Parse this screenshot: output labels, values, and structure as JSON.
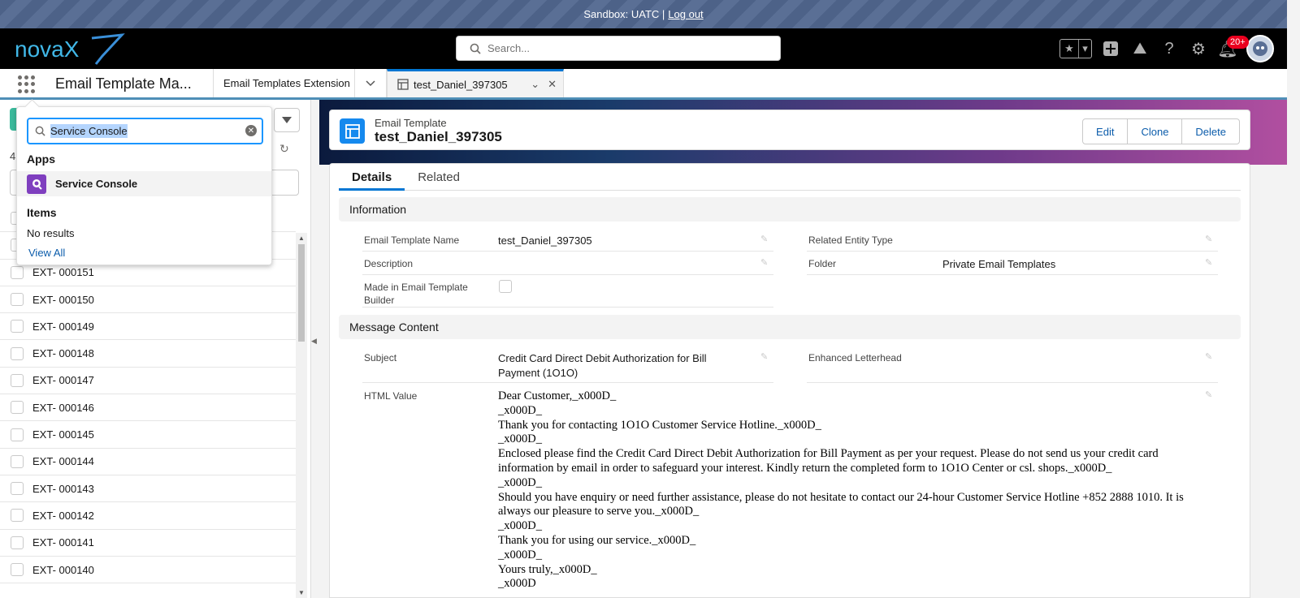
{
  "sandbox": {
    "text": "Sandbox: UATC |",
    "logout": "Log out"
  },
  "header": {
    "logo": "novaX",
    "search_placeholder": "Search...",
    "notif_badge": "20+"
  },
  "nav": {
    "app_name": "Email Template Ma...",
    "tabs": [
      {
        "label": "Email Templates Extension"
      },
      {
        "label": "test_Daniel_397305"
      }
    ]
  },
  "launcher": {
    "search_value": "Service Console",
    "apps_heading": "Apps",
    "app_result": "Service Console",
    "items_heading": "Items",
    "no_results": "No results",
    "view_all": "View All"
  },
  "left_panel": {
    "count_prefix": "4",
    "rows": [
      "EXT- 000151",
      "EXT- 000150",
      "EXT- 000149",
      "EXT- 000148",
      "EXT- 000147",
      "EXT- 000146",
      "EXT- 000145",
      "EXT- 000144",
      "EXT- 000143",
      "EXT- 000142",
      "EXT- 000141",
      "EXT- 000140"
    ]
  },
  "record": {
    "type": "Email Template",
    "title": "test_Daniel_397305",
    "actions": {
      "edit": "Edit",
      "clone": "Clone",
      "delete": "Delete"
    },
    "tabs": {
      "details": "Details",
      "related": "Related"
    },
    "sections": {
      "information": "Information",
      "message_content": "Message Content"
    },
    "fields": {
      "name_label": "Email Template Name",
      "name_value": "test_Daniel_397305",
      "description_label": "Description",
      "builder_label": "Made in Email Template Builder",
      "related_entity_label": "Related Entity Type",
      "folder_label": "Folder",
      "folder_value": "Private Email Templates",
      "subject_label": "Subject",
      "subject_value": "Credit Card Direct Debit Authorization for Bill Payment (1O1O)",
      "letterhead_label": "Enhanced Letterhead",
      "html_label": "HTML Value"
    },
    "html_lines": [
      "Dear Customer,_x000D_",
      "_x000D_",
      "Thank you for contacting 1O1O Customer Service Hotline._x000D_",
      "_x000D_",
      "Enclosed please find the Credit Card Direct Debit Authorization for Bill Payment as per your request. Please do not send us your credit card information by email in order to safeguard your interest. Kindly return the completed form to 1O1O Center or csl. shops._x000D_",
      "_x000D_",
      "Should you have enquiry or need further assistance, please do not hesitate to contact our 24-hour Customer Service Hotline +852 2888 1010. It is always our pleasure to serve you._x000D_",
      "_x000D_",
      "Thank you for using our service._x000D_",
      "_x000D_",
      "Yours truly,_x000D_",
      "_x000D"
    ]
  },
  "colors": {
    "brand_blue": "#0176d3",
    "link": "#0b5cab",
    "badge": "#ea001e",
    "accent_green": "#3bba9c"
  }
}
